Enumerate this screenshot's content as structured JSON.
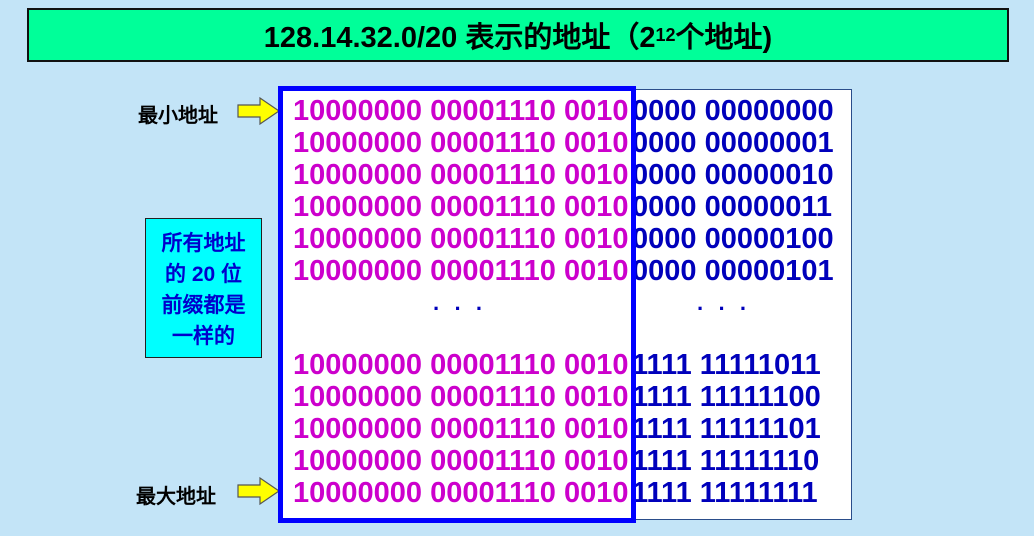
{
  "title": {
    "main": "128.14.32.0/20 表示的地址（2",
    "exp": "12",
    "tail": " 个地址)"
  },
  "labels": {
    "min": "最小地址",
    "max": "最大地址"
  },
  "note": [
    "所有地址",
    "的 20 位",
    "前缀都是",
    "一样的"
  ],
  "prefix": "10000000 00001110 0010",
  "top_rows": [
    "0000 00000000",
    "0000 00000001",
    "0000 00000010",
    "0000 00000011",
    "0000 00000100",
    "0000 00000101"
  ],
  "ellipsis": "· · ·",
  "bottom_rows": [
    "1111 11111011",
    "1111 11111100",
    "1111 11111101",
    "1111 11111110",
    "1111 11111111"
  ],
  "colors": {
    "prefix": "#cc00cc",
    "suffix": "#0000bb",
    "title_bg": "#00ff99",
    "note_bg": "#00ffff"
  }
}
